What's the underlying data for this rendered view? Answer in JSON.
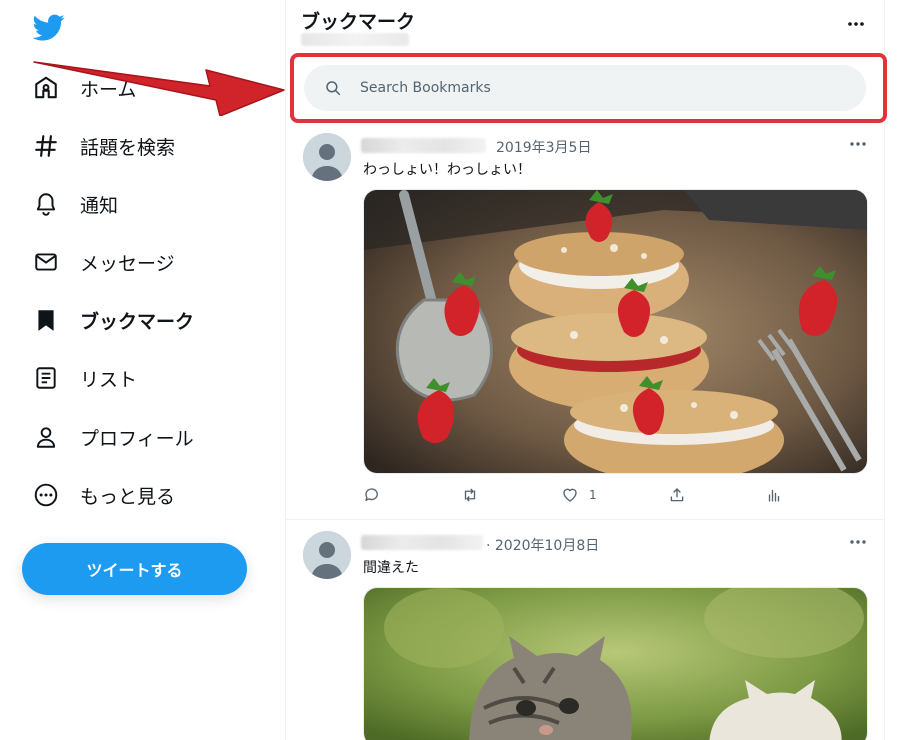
{
  "sidebar": {
    "logo": "twitter-bird-icon",
    "items": [
      {
        "label": "ホーム",
        "icon": "home-icon"
      },
      {
        "label": "話題を検索",
        "icon": "hashtag-icon"
      },
      {
        "label": "通知",
        "icon": "bell-icon"
      },
      {
        "label": "メッセージ",
        "icon": "envelope-icon"
      },
      {
        "label": "ブックマーク",
        "icon": "bookmark-icon",
        "active": true
      },
      {
        "label": "リスト",
        "icon": "list-icon"
      },
      {
        "label": "プロフィール",
        "icon": "person-icon"
      },
      {
        "label": "もっと見る",
        "icon": "more-circle-icon"
      }
    ],
    "tweet_button": "ツイートする"
  },
  "header": {
    "title": "ブックマーク"
  },
  "search": {
    "placeholder": "Search Bookmarks"
  },
  "tweets": [
    {
      "date": "2019年3月5日",
      "text": "わっしょい！わっしょい！",
      "image": "strawberry-cream-puffs-photo",
      "like_count": "1"
    },
    {
      "date": "· 2020年10月8日",
      "text": "間違えた",
      "image": "kittens-photo"
    }
  ],
  "colors": {
    "accent": "#1d9bf0",
    "highlight_outline": "#e1333b",
    "muted_text": "#536471"
  }
}
